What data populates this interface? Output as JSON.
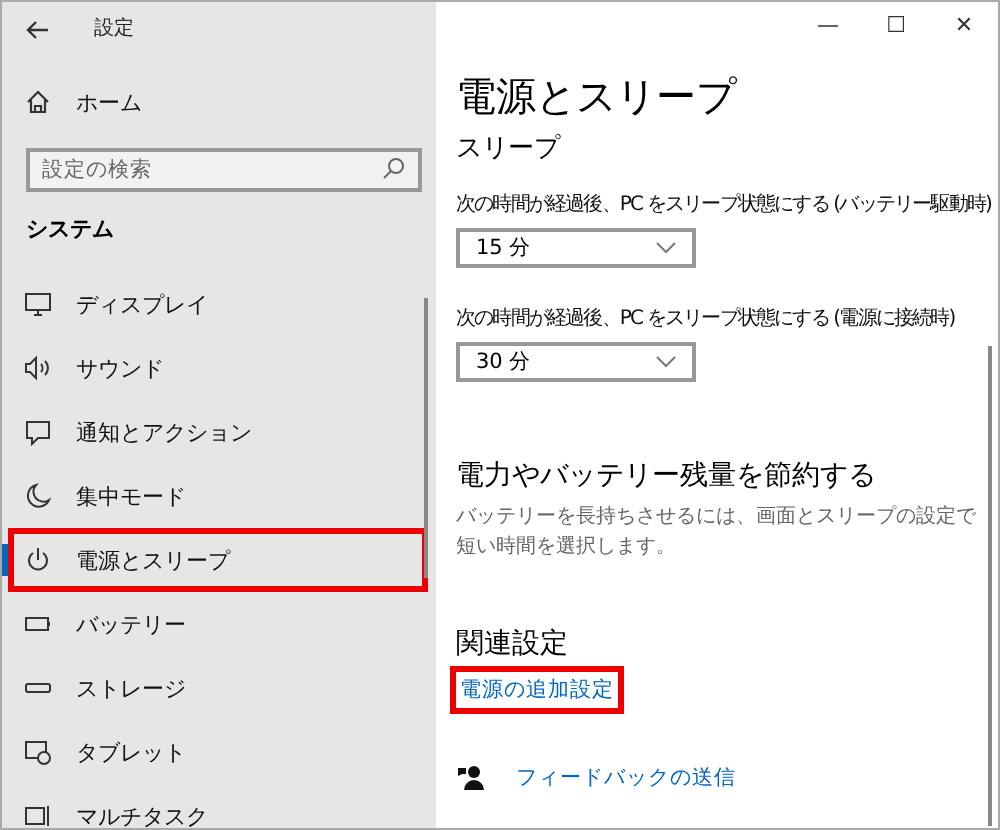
{
  "window": {
    "title": "設定",
    "controls": [
      "—",
      "☐",
      "✕"
    ]
  },
  "sidebar": {
    "home": "ホーム",
    "search": {
      "placeholder": "設定の検索"
    },
    "section": "システム",
    "items": [
      {
        "label": "ディスプレイ",
        "kind": "display",
        "selected": false,
        "highlighted": false
      },
      {
        "label": "サウンド",
        "kind": "sound",
        "selected": false,
        "highlighted": false
      },
      {
        "label": "通知とアクション",
        "kind": "notify",
        "selected": false,
        "highlighted": false
      },
      {
        "label": "集中モード",
        "kind": "moon",
        "selected": false,
        "highlighted": false
      },
      {
        "label": "電源とスリープ",
        "kind": "power",
        "selected": true,
        "highlighted": true
      },
      {
        "label": "バッテリー",
        "kind": "battery",
        "selected": false,
        "highlighted": false
      },
      {
        "label": "ストレージ",
        "kind": "storage",
        "selected": false,
        "highlighted": false
      },
      {
        "label": "タブレット",
        "kind": "tablet",
        "selected": false,
        "highlighted": false
      },
      {
        "label": "マルチタスク",
        "kind": "multi",
        "selected": false,
        "highlighted": false
      }
    ]
  },
  "content": {
    "title": "電源とスリープ",
    "sleep_heading": "スリープ",
    "dropdowns": [
      {
        "label": "次の時間が経過後、PC をスリープ状態にする (バッテリー駆動時)",
        "value": "15 分"
      },
      {
        "label": "次の時間が経過後、PC をスリープ状態にする (電源に接続時)",
        "value": "30 分"
      }
    ],
    "save_heading": "電力やバッテリー残量を節約する",
    "save_text": "バッテリーを長持ちさせるには、画面とスリープの設定で短い時間を選択します。",
    "related_heading": "関連設定",
    "related_link": {
      "label": "電源の追加設定",
      "highlighted": true
    },
    "feedback": "フィードバックの送信"
  }
}
